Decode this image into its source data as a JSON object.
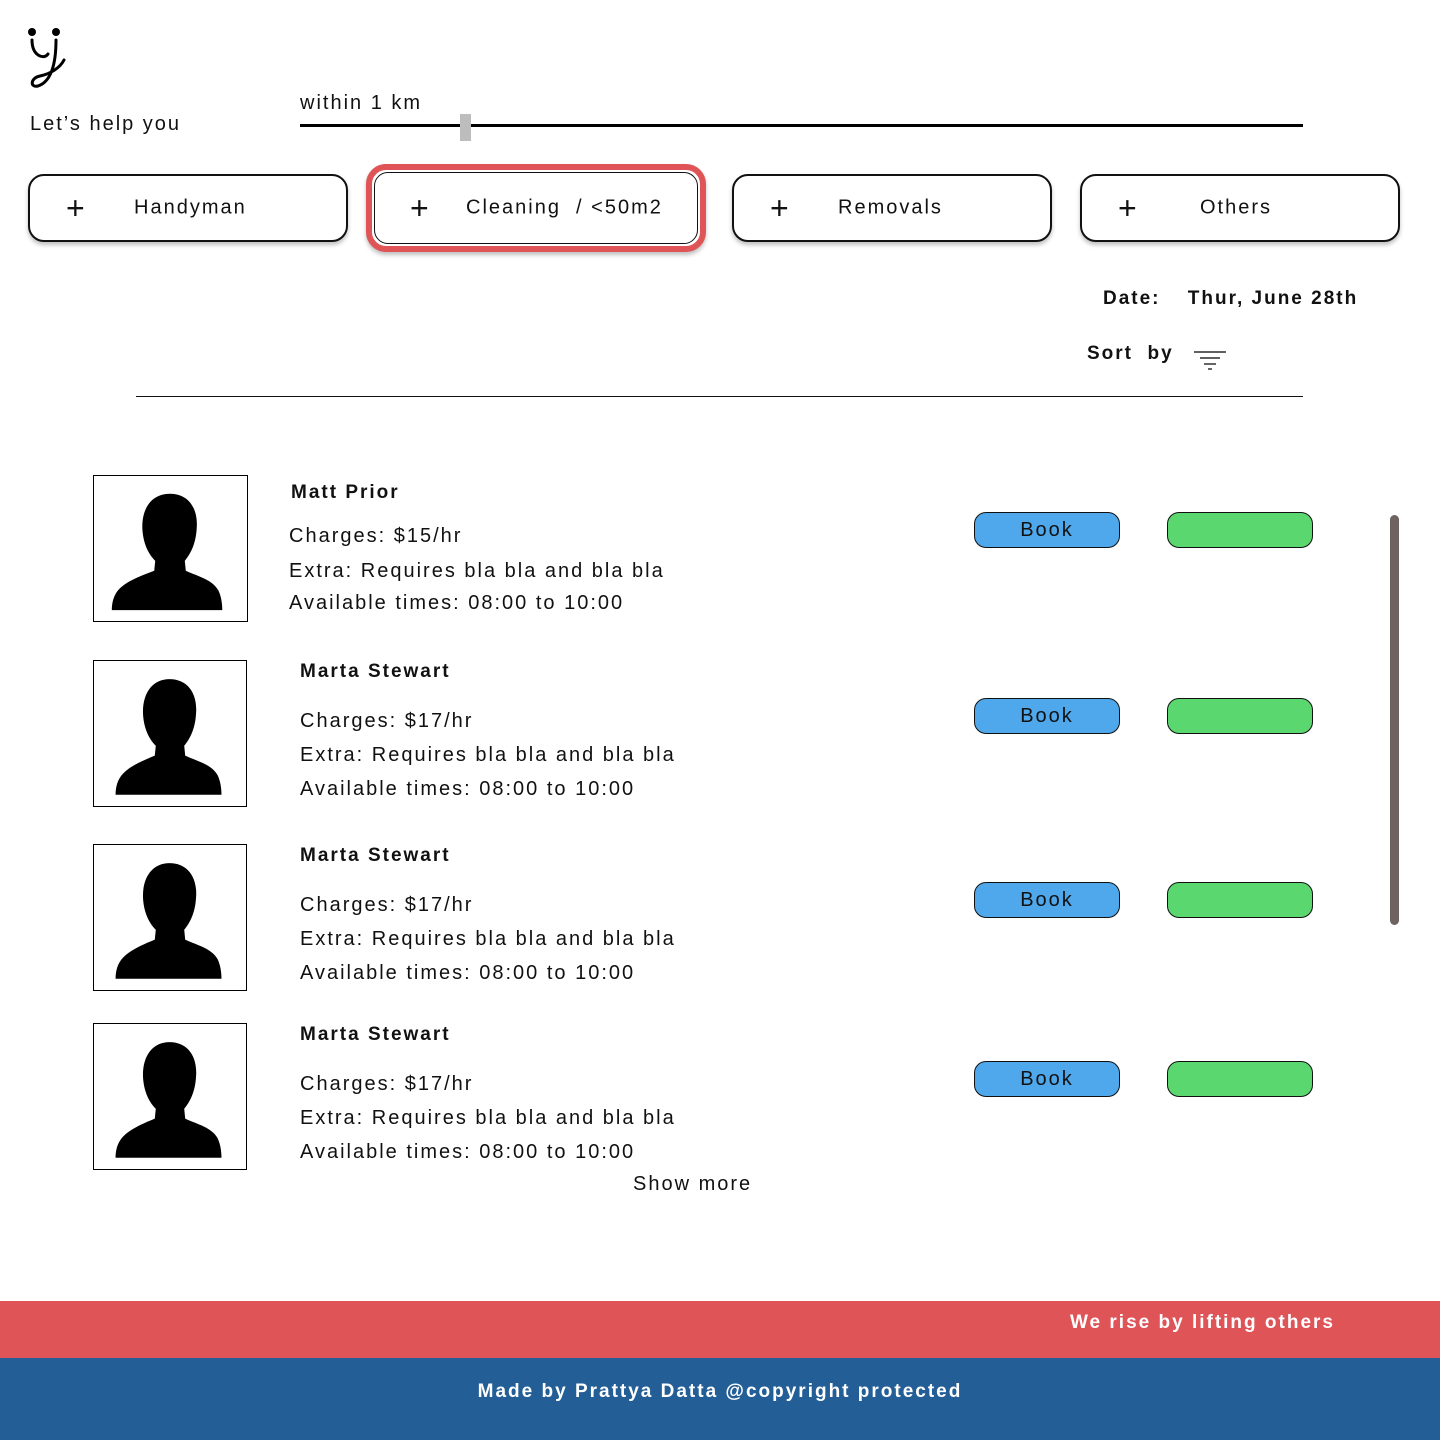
{
  "brand": {
    "tagline": "Let’s help you"
  },
  "filter": {
    "distance_label": "within 1 km",
    "distance_km": 1
  },
  "categories": [
    {
      "label": "Handyman",
      "icon": "plus-icon",
      "selected": false
    },
    {
      "label": "Cleaning  / <50m2",
      "icon": "plus-icon",
      "selected": true
    },
    {
      "label": "Removals",
      "icon": "plus-icon",
      "selected": false
    },
    {
      "label": "Others",
      "icon": "plus-icon",
      "selected": false
    }
  ],
  "date": {
    "label": "Date:",
    "value": "Thur, June 28th"
  },
  "sort": {
    "label": "Sort  by",
    "icon": "filter-icon"
  },
  "providers": [
    {
      "name": "Matt Prior",
      "charges": "Charges: $15/hr",
      "extra": "Extra: Requires bla bla and bla bla",
      "times": "Available times: 08:00 to 10:00",
      "book_label": "Book"
    },
    {
      "name": "Marta Stewart",
      "charges": "Charges: $17/hr",
      "extra": "Extra: Requires bla bla and bla bla",
      "times": "Available times: 08:00 to 10:00",
      "book_label": "Book"
    },
    {
      "name": "Marta Stewart",
      "charges": "Charges: $17/hr",
      "extra": "Extra: Requires bla bla and bla bla",
      "times": "Available times: 08:00 to 10:00",
      "book_label": "Book"
    },
    {
      "name": "Marta Stewart",
      "charges": "Charges: $17/hr",
      "extra": "Extra: Requires bla bla and bla bla",
      "times": "Available times: 08:00 to 10:00",
      "book_label": "Book"
    }
  ],
  "list": {
    "show_more_label": "Show more"
  },
  "footer": {
    "motto": "We rise by lifting others",
    "credit": "Made by Prattya Datta @copyright protected"
  },
  "colors": {
    "accent_red": "#de5457",
    "book_blue": "#4fa8ec",
    "action_green": "#5ad86f",
    "footer_blue": "#235e96",
    "scrollbar": "#6e6361"
  }
}
